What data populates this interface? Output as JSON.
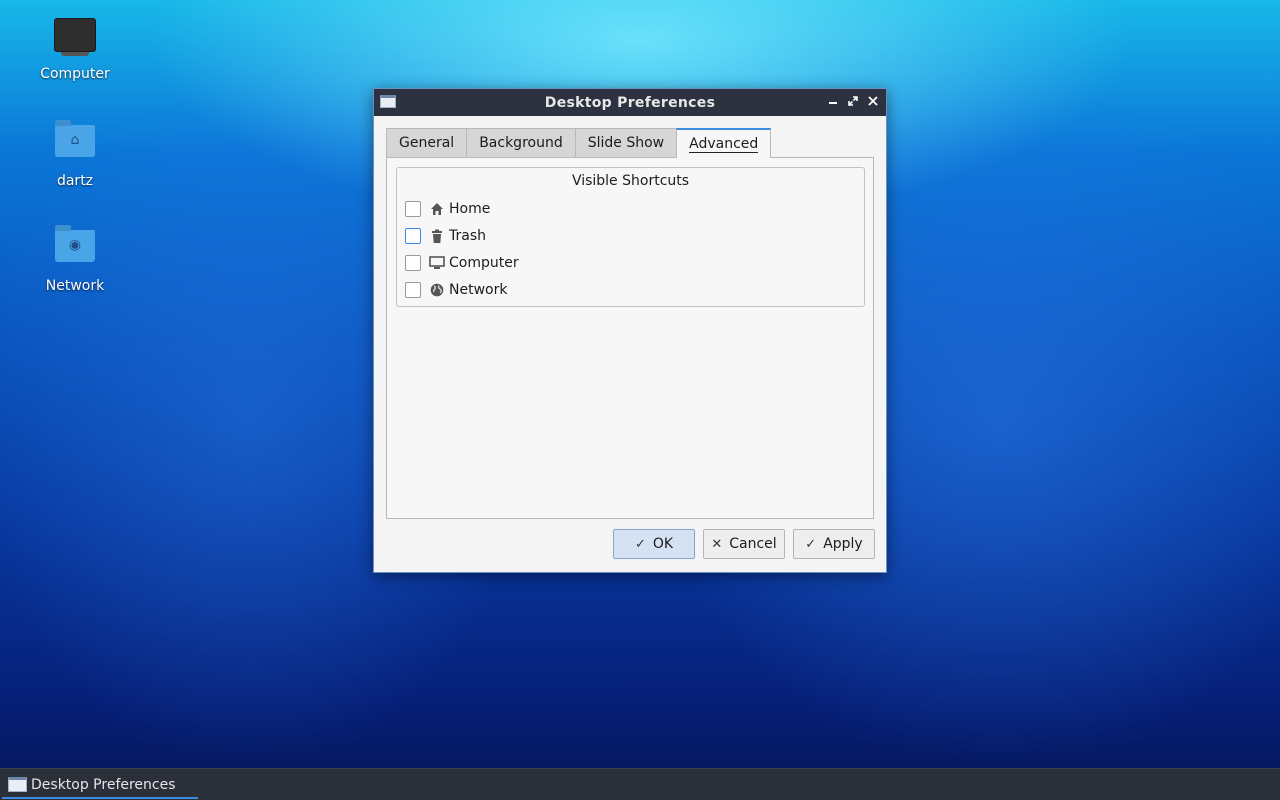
{
  "desktop": {
    "icons": [
      {
        "label": "Computer",
        "icon": "computer-icon"
      },
      {
        "label": "dartz",
        "icon": "home-folder-icon"
      },
      {
        "label": "Network",
        "icon": "network-folder-icon"
      }
    ]
  },
  "dialog": {
    "title": "Desktop Preferences",
    "window_buttons": [
      "minimize",
      "maximize",
      "close"
    ],
    "tabs": [
      {
        "label": "General",
        "active": false
      },
      {
        "label": "Background",
        "active": false
      },
      {
        "label": "Slide Show",
        "active": false
      },
      {
        "label": "Advanced",
        "active": true
      }
    ],
    "advanced": {
      "group_title": "Visible Shortcuts",
      "shortcuts": [
        {
          "label": "Home",
          "icon": "home-icon",
          "checked": false
        },
        {
          "label": "Trash",
          "icon": "trash-icon",
          "checked": false
        },
        {
          "label": "Computer",
          "icon": "monitor-icon",
          "checked": false
        },
        {
          "label": "Network",
          "icon": "globe-icon",
          "checked": false
        }
      ]
    },
    "buttons": {
      "ok": "OK",
      "cancel": "Cancel",
      "apply": "Apply"
    }
  },
  "taskbar": {
    "items": [
      {
        "label": "Desktop Preferences",
        "active": true
      }
    ]
  },
  "colors": {
    "accent": "#3d8be0",
    "titlebar": "#2d3240",
    "taskbar": "#2b2f3a"
  }
}
